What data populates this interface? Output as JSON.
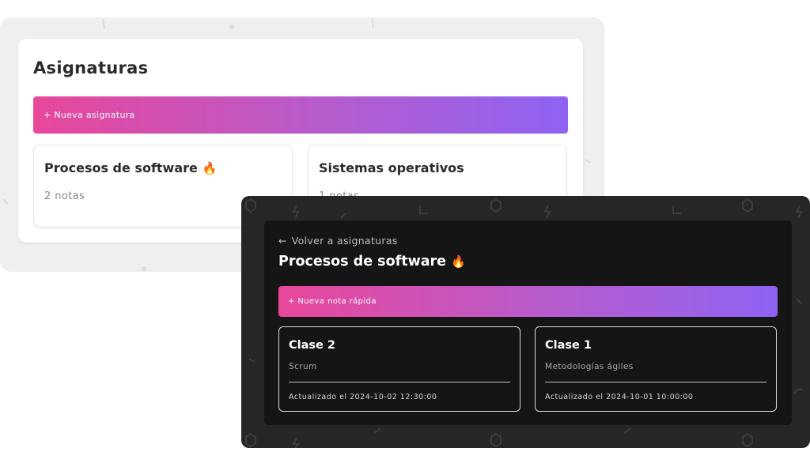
{
  "light": {
    "title": "Asignaturas",
    "new_subject_label": "+ Nueva asignatura",
    "subjects": [
      {
        "name": "Procesos de software",
        "icon": "🔥",
        "notes": "2 notas"
      },
      {
        "name": "Sistemas operativos",
        "notes": "1 notas"
      }
    ]
  },
  "dark": {
    "back_arrow": "←",
    "back_label": "Volver a asignaturas",
    "title": "Procesos de software",
    "title_icon": "🔥",
    "quick_note_label": "+ Nueva nota rápida",
    "notes": [
      {
        "title": "Clase 2",
        "subtitle": "Scrum",
        "updated": "Actualizado el 2024-10-02 12:30:00"
      },
      {
        "title": "Clase 1",
        "subtitle": "Metodologías ágiles",
        "updated": "Actualizado el 2024-10-01 10:00:00"
      }
    ]
  },
  "colors": {
    "gradient_start": "#e8479a",
    "gradient_end": "#8e63f3",
    "dark_bg": "#262626",
    "dark_card": "#151515",
    "light_bg": "#efefef"
  }
}
